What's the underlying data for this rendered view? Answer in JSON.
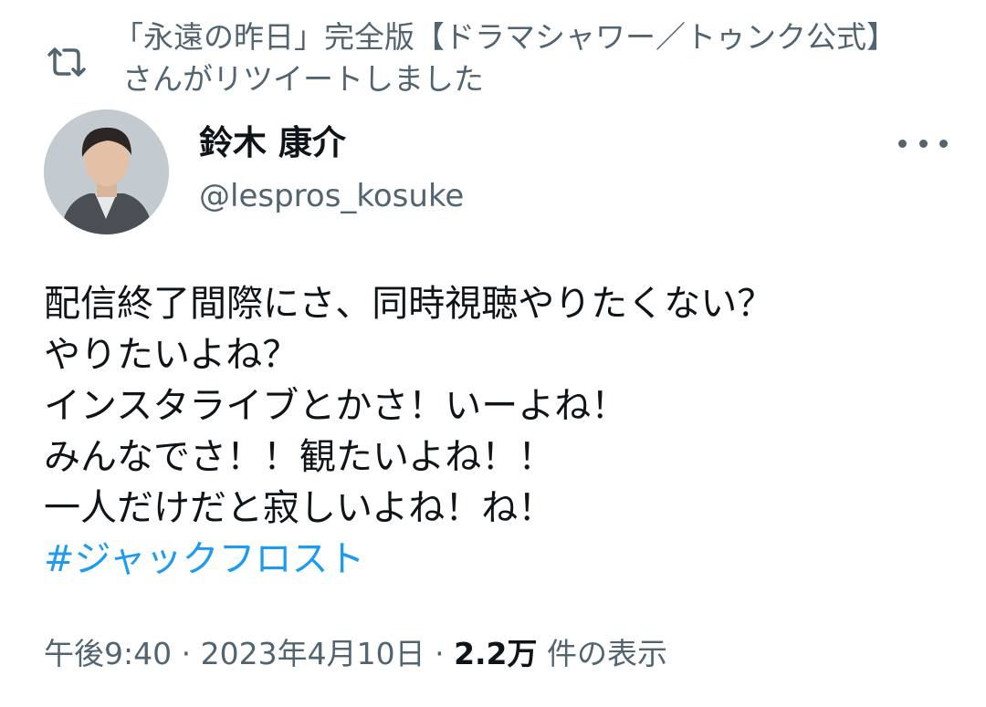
{
  "retweet": {
    "icon": "retweet-icon",
    "text": "「永遠の昨日」完全版【ドラマシャワー／トゥンク公式】さんがリツイートしました"
  },
  "author": {
    "display_name": "鈴木 康介",
    "handle": "@lespros_kosuke",
    "more_icon": "more-dots-icon"
  },
  "tweet": {
    "lines": [
      "配信終了間際にさ、同時視聴やりたくない？",
      "やりたいよね？",
      "インスタライブとかさ！いーよね！",
      "みんなでさ！！観たいよね！！",
      "一人だけだと寂しいよね！ね！"
    ],
    "hashtag": "#ジャックフロスト"
  },
  "meta": {
    "time": "午後9:40",
    "separator1": " · ",
    "date": "2023年4月10日",
    "separator2": " · ",
    "views_count": "2.2万",
    "views_label": " 件の表示"
  },
  "colors": {
    "text": "#0f1419",
    "secondary": "#536471",
    "link": "#1d9bf0"
  }
}
